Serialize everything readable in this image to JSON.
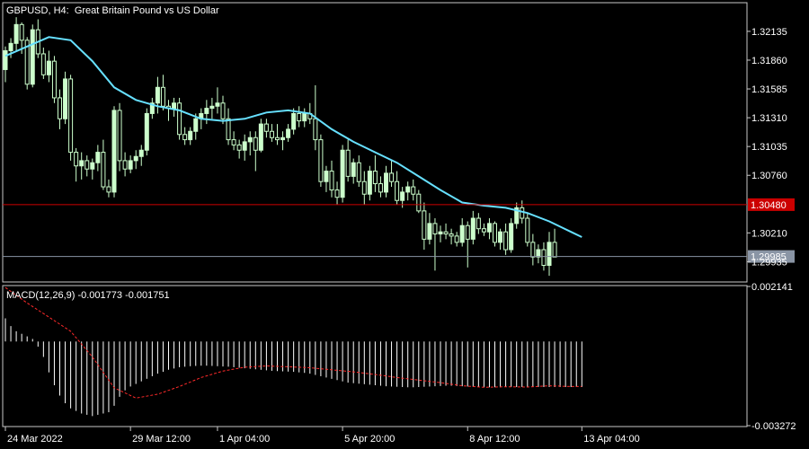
{
  "chart_data": {
    "type": "candlestick",
    "symbol": "GBPUSD",
    "timeframe": "H4",
    "description": "Great Britain Pound vs US Dollar",
    "price_ticks": [
      "1.32135",
      "1.31860",
      "1.31585",
      "1.31310",
      "1.31035",
      "1.30760",
      "1.30210",
      "1.29935"
    ],
    "price_range": [
      1.2975,
      1.324
    ],
    "resistance_line": {
      "value": "1.30480",
      "numeric": 1.3048,
      "color": "#cc0000"
    },
    "current_price": {
      "value": "1.29985",
      "numeric": 1.29985,
      "color": "#8a95a5"
    },
    "time_labels": [
      "24 Mar 2022",
      "29 Mar 12:00",
      "1 Apr 04:00",
      "5 Apr 20:00",
      "8 Apr 12:00",
      "13 Apr 04:00"
    ],
    "time_label_bar_index": [
      0,
      23,
      39,
      62,
      85,
      106
    ],
    "candle_color": "#ccffcc",
    "ma_color": "#66e0ff",
    "candles": [
      [
        1.3177,
        1.3199,
        1.3165,
        1.3195
      ],
      [
        1.3195,
        1.3207,
        1.3188,
        1.3202
      ],
      [
        1.3202,
        1.3227,
        1.3195,
        1.322
      ],
      [
        1.322,
        1.3222,
        1.3192,
        1.3205
      ],
      [
        1.3205,
        1.3208,
        1.3158,
        1.3163
      ],
      [
        1.3163,
        1.322,
        1.316,
        1.3215
      ],
      [
        1.3215,
        1.3225,
        1.3188,
        1.3192
      ],
      [
        1.3192,
        1.3198,
        1.3168,
        1.3172
      ],
      [
        1.3172,
        1.3195,
        1.3165,
        1.3185
      ],
      [
        1.3185,
        1.319,
        1.3145,
        1.315
      ],
      [
        1.315,
        1.3158,
        1.312,
        1.313
      ],
      [
        1.313,
        1.3175,
        1.3125,
        1.3168
      ],
      [
        1.3168,
        1.3172,
        1.309,
        1.3098
      ],
      [
        1.3098,
        1.3102,
        1.307,
        1.3085
      ],
      [
        1.3085,
        1.3098,
        1.3072,
        1.309
      ],
      [
        1.309,
        1.3095,
        1.3075,
        1.3082
      ],
      [
        1.3082,
        1.3092,
        1.3072,
        1.3088
      ],
      [
        1.3088,
        1.3105,
        1.308,
        1.3098
      ],
      [
        1.3098,
        1.311,
        1.3062,
        1.3065
      ],
      [
        1.3065,
        1.3072,
        1.3055,
        1.306
      ],
      [
        1.306,
        1.3142,
        1.3055,
        1.3138
      ],
      [
        1.3138,
        1.3145,
        1.308,
        1.309
      ],
      [
        1.309,
        1.3098,
        1.3075,
        1.3082
      ],
      [
        1.3082,
        1.3095,
        1.3078,
        1.309
      ],
      [
        1.309,
        1.31,
        1.3082,
        1.3094
      ],
      [
        1.3094,
        1.3105,
        1.3085,
        1.31
      ],
      [
        1.31,
        1.314,
        1.3095,
        1.3135
      ],
      [
        1.3135,
        1.315,
        1.313,
        1.3145
      ],
      [
        1.3145,
        1.317,
        1.3135,
        1.316
      ],
      [
        1.316,
        1.3172,
        1.3138,
        1.3142
      ],
      [
        1.3142,
        1.3148,
        1.3128,
        1.314
      ],
      [
        1.314,
        1.315,
        1.3132,
        1.3145
      ],
      [
        1.3145,
        1.315,
        1.311,
        1.3115
      ],
      [
        1.3115,
        1.3122,
        1.3105,
        1.311
      ],
      [
        1.311,
        1.3122,
        1.3105,
        1.3118
      ],
      [
        1.3118,
        1.3135,
        1.311,
        1.313
      ],
      [
        1.313,
        1.314,
        1.312,
        1.3135
      ],
      [
        1.3135,
        1.3148,
        1.3125,
        1.314
      ],
      [
        1.314,
        1.315,
        1.313,
        1.3142
      ],
      [
        1.3142,
        1.316,
        1.3135,
        1.3145
      ],
      [
        1.3145,
        1.3152,
        1.3125,
        1.313
      ],
      [
        1.313,
        1.314,
        1.3105,
        1.311
      ],
      [
        1.311,
        1.3118,
        1.31,
        1.3105
      ],
      [
        1.3105,
        1.311,
        1.3092,
        1.31
      ],
      [
        1.31,
        1.3115,
        1.309,
        1.3108
      ],
      [
        1.3108,
        1.3118,
        1.3095,
        1.3112
      ],
      [
        1.3112,
        1.3118,
        1.308,
        1.31
      ],
      [
        1.31,
        1.313,
        1.3098,
        1.3125
      ],
      [
        1.3125,
        1.313,
        1.3112,
        1.3118
      ],
      [
        1.3118,
        1.3125,
        1.3108,
        1.3112
      ],
      [
        1.3112,
        1.3125,
        1.3105,
        1.311
      ],
      [
        1.311,
        1.3118,
        1.31,
        1.3112
      ],
      [
        1.3112,
        1.3125,
        1.3108,
        1.312
      ],
      [
        1.312,
        1.314,
        1.3115,
        1.3135
      ],
      [
        1.3135,
        1.3142,
        1.3122,
        1.3128
      ],
      [
        1.3128,
        1.314,
        1.3122,
        1.3135
      ],
      [
        1.3135,
        1.3145,
        1.3125,
        1.313
      ],
      [
        1.313,
        1.3162,
        1.31,
        1.311
      ],
      [
        1.311,
        1.3115,
        1.3065,
        1.307
      ],
      [
        1.307,
        1.3085,
        1.306,
        1.308
      ],
      [
        1.308,
        1.309,
        1.3055,
        1.3062
      ],
      [
        1.3062,
        1.307,
        1.3048,
        1.3055
      ],
      [
        1.3055,
        1.3105,
        1.305,
        1.31
      ],
      [
        1.31,
        1.311,
        1.307,
        1.3075
      ],
      [
        1.3075,
        1.3092,
        1.3068,
        1.3088
      ],
      [
        1.3088,
        1.3095,
        1.3065,
        1.307
      ],
      [
        1.307,
        1.308,
        1.3048,
        1.3058
      ],
      [
        1.3058,
        1.3085,
        1.3052,
        1.308
      ],
      [
        1.308,
        1.3095,
        1.306,
        1.3068
      ],
      [
        1.3068,
        1.3075,
        1.3055,
        1.306
      ],
      [
        1.306,
        1.3085,
        1.3055,
        1.3078
      ],
      [
        1.3078,
        1.309,
        1.3065,
        1.307
      ],
      [
        1.307,
        1.308,
        1.3048,
        1.3052
      ],
      [
        1.3052,
        1.3065,
        1.3045,
        1.306
      ],
      [
        1.306,
        1.307,
        1.3052,
        1.3065
      ],
      [
        1.3065,
        1.3072,
        1.3052,
        1.3058
      ],
      [
        1.3058,
        1.3062,
        1.304,
        1.3042
      ],
      [
        1.3042,
        1.305,
        1.3005,
        1.3015
      ],
      [
        1.3015,
        1.304,
        1.301,
        1.303
      ],
      [
        1.303,
        1.3035,
        1.2985,
        1.302
      ],
      [
        1.302,
        1.3028,
        1.3012,
        1.3022
      ],
      [
        1.3022,
        1.303,
        1.3015,
        1.302
      ],
      [
        1.302,
        1.3025,
        1.301,
        1.3018
      ],
      [
        1.3018,
        1.3022,
        1.3008,
        1.3012
      ],
      [
        1.3012,
        1.3035,
        1.3008,
        1.3028
      ],
      [
        1.3028,
        1.3032,
        1.2988,
        1.3015
      ],
      [
        1.3015,
        1.3042,
        1.301,
        1.3035
      ],
      [
        1.3035,
        1.304,
        1.302,
        1.3025
      ],
      [
        1.3025,
        1.303,
        1.3018,
        1.3022
      ],
      [
        1.3022,
        1.3035,
        1.3015,
        1.303
      ],
      [
        1.303,
        1.3032,
        1.3008,
        1.3012
      ],
      [
        1.3012,
        1.3025,
        1.3005,
        1.3022
      ],
      [
        1.3022,
        1.303,
        1.3,
        1.3005
      ],
      [
        1.3005,
        1.3035,
        1.3002,
        1.303
      ],
      [
        1.303,
        1.305,
        1.3025,
        1.3045
      ],
      [
        1.3045,
        1.3052,
        1.303,
        1.3035
      ],
      [
        1.3035,
        1.304,
        1.3008,
        1.3012
      ],
      [
        1.3012,
        1.302,
        1.299,
        1.2998
      ],
      [
        1.2998,
        1.301,
        1.2992,
        1.3005
      ],
      [
        1.3005,
        1.3012,
        1.2985,
        1.299
      ],
      [
        1.299,
        1.3022,
        1.298,
        1.3012
      ],
      [
        1.3012,
        1.3025,
        1.3,
        1.2998
      ]
    ],
    "ma_points": [
      [
        0,
        1.319
      ],
      [
        8,
        1.3208
      ],
      [
        12,
        1.3205
      ],
      [
        16,
        1.3185
      ],
      [
        20,
        1.316
      ],
      [
        24,
        1.3148
      ],
      [
        28,
        1.3142
      ],
      [
        32,
        1.3138
      ],
      [
        36,
        1.313
      ],
      [
        40,
        1.3128
      ],
      [
        44,
        1.313
      ],
      [
        48,
        1.3136
      ],
      [
        52,
        1.3138
      ],
      [
        56,
        1.3135
      ],
      [
        60,
        1.312
      ],
      [
        64,
        1.3108
      ],
      [
        68,
        1.3098
      ],
      [
        72,
        1.3088
      ],
      [
        76,
        1.3075
      ],
      [
        80,
        1.3062
      ],
      [
        84,
        1.305
      ],
      [
        88,
        1.3047
      ],
      [
        92,
        1.3045
      ],
      [
        96,
        1.304
      ],
      [
        100,
        1.3032
      ],
      [
        104,
        1.3022
      ],
      [
        106,
        1.3017
      ]
    ],
    "macd": {
      "label": "MACD(12,26,9) -0.001773 -0.001751",
      "ticks": [
        "0.002141",
        "-0.003272"
      ],
      "range": [
        -0.003272,
        0.002141
      ],
      "histogram_color": "#ffffff",
      "signal_color": "#ff2a2a",
      "histogram": [
        0.0009,
        0.0006,
        0.0004,
        0.0003,
        0.0002,
        0.0001,
        -0.0002,
        -0.0006,
        -0.0012,
        -0.0017,
        -0.0021,
        -0.0024,
        -0.0026,
        -0.0027,
        -0.0028,
        -0.00285,
        -0.0029,
        -0.00285,
        -0.0028,
        -0.00275,
        -0.0025,
        -0.00215,
        -0.0019,
        -0.00175,
        -0.00165,
        -0.00155,
        -0.00145,
        -0.00135,
        -0.00125,
        -0.00118,
        -0.0011,
        -0.00105,
        -0.001,
        -0.00098,
        -0.00096,
        -0.00095,
        -0.00094,
        -0.00094,
        -0.00095,
        -0.00096,
        -0.00097,
        -0.00098,
        -0.001,
        -0.00102,
        -0.00104,
        -0.00106,
        -0.00108,
        -0.0011,
        -0.00112,
        -0.00114,
        -0.00115,
        -0.00116,
        -0.00117,
        -0.00118,
        -0.0012,
        -0.00122,
        -0.00125,
        -0.0013,
        -0.00135,
        -0.0014,
        -0.00145,
        -0.0015,
        -0.00155,
        -0.0016,
        -0.00162,
        -0.00164,
        -0.00166,
        -0.00168,
        -0.0017,
        -0.00172,
        -0.00174,
        -0.00175,
        -0.00176,
        -0.00177,
        -0.00178,
        -0.00178,
        -0.00177,
        -0.00176,
        -0.00175,
        -0.00174,
        -0.00173,
        -0.00172,
        -0.00172,
        -0.00173,
        -0.00174,
        -0.00175,
        -0.00176,
        -0.00177,
        -0.00178,
        -0.00178,
        -0.00178,
        -0.00178,
        -0.00177,
        -0.00177,
        -0.00177,
        -0.00177,
        -0.00177,
        -0.00177,
        -0.00177,
        -0.00177,
        -0.00177,
        -0.00177,
        -0.00177,
        -0.00177,
        -0.00177,
        -0.00177,
        -0.00177
      ],
      "signal_points": [
        [
          0,
          0.0021
        ],
        [
          4,
          0.0015
        ],
        [
          8,
          0.00095
        ],
        [
          12,
          0.0004
        ],
        [
          16,
          -0.0006
        ],
        [
          20,
          -0.0018
        ],
        [
          24,
          -0.0022
        ],
        [
          28,
          -0.00205
        ],
        [
          32,
          -0.00175
        ],
        [
          36,
          -0.0014
        ],
        [
          40,
          -0.00115
        ],
        [
          44,
          -0.001
        ],
        [
          48,
          -0.00095
        ],
        [
          52,
          -0.00098
        ],
        [
          56,
          -0.00102
        ],
        [
          60,
          -0.0011
        ],
        [
          64,
          -0.00118
        ],
        [
          68,
          -0.00128
        ],
        [
          72,
          -0.0014
        ],
        [
          76,
          -0.0015
        ],
        [
          80,
          -0.0016
        ],
        [
          84,
          -0.00172
        ],
        [
          88,
          -0.00178
        ],
        [
          92,
          -0.00176
        ],
        [
          96,
          -0.00177
        ],
        [
          100,
          -0.00172
        ],
        [
          104,
          -0.00175
        ],
        [
          106,
          -0.00175
        ]
      ]
    }
  }
}
